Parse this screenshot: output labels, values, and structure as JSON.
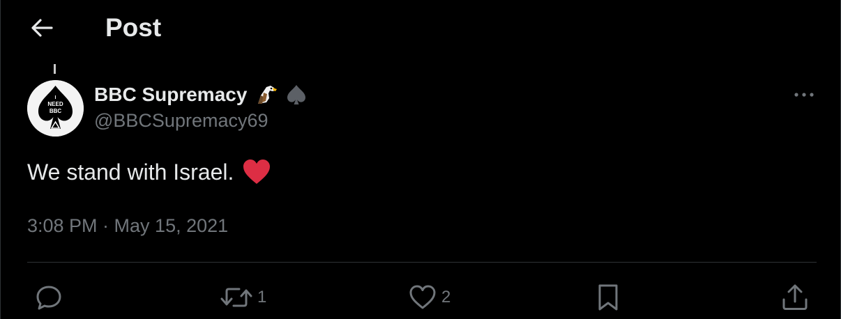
{
  "header": {
    "title": "Post",
    "back_icon": "arrow-left-icon"
  },
  "author": {
    "display_name": "BBC Supremacy",
    "handle": "@BBCSupremacy69",
    "name_emojis": [
      "eagle-icon",
      "spade-icon"
    ],
    "avatar": {
      "description": "spade-logo-avatar",
      "text_line1": "I",
      "text_line2": "NEED",
      "text_line3": "BBC"
    }
  },
  "post": {
    "text": "We stand with Israel.",
    "emoji": "red-heart-icon",
    "timestamp": "3:08 PM · May 15, 2021"
  },
  "actions": {
    "reply": {
      "icon": "reply-icon",
      "count": ""
    },
    "repost": {
      "icon": "repost-icon",
      "count": "1"
    },
    "like": {
      "icon": "heart-icon",
      "count": "2"
    },
    "bookmark": {
      "icon": "bookmark-icon",
      "count": ""
    },
    "share": {
      "icon": "share-icon",
      "count": ""
    }
  },
  "colors": {
    "background": "#000000",
    "primary_text": "#e7e9ea",
    "secondary_text": "#71767b",
    "divider": "#2f3336",
    "heart_red": "#e0245e"
  }
}
